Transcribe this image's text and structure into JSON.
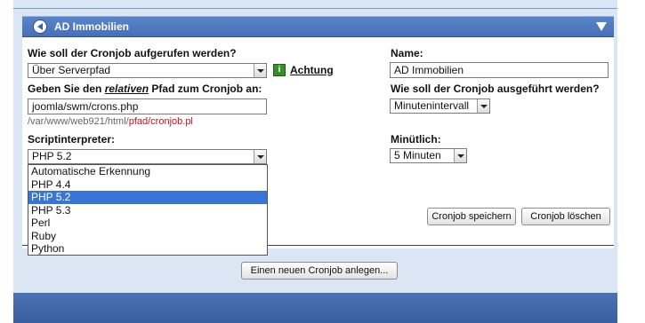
{
  "panel": {
    "title": "AD Immobilien",
    "header_icon": "back-arrow-icon",
    "collapse_icon": "collapse-triangle-icon"
  },
  "form": {
    "call_question": "Wie soll der Cronjob aufgerufen werden?",
    "call_method_value": "Über Serverpfad",
    "warning_icon": "info-icon",
    "warning_icon_glyph": "i",
    "warning_link": "Achtung",
    "path_label_pre": "Geben Sie den ",
    "path_label_em": "relativen",
    "path_label_post": " Pfad zum Cronjob an:",
    "path_value": "joomla/swm/crons.php",
    "path_hint_grey": "/var/www/web921/html/",
    "path_hint_red": "pfad/cronjob.pl",
    "interpreter_label": "Scriptinterpreter:",
    "interpreter_value": "PHP 5.2",
    "interpreter_options": [
      "Automatische Erkennung",
      "PHP 4.4",
      "PHP 5.2",
      "PHP 5.3",
      "Perl",
      "Ruby",
      "Python"
    ],
    "interpreter_selected_index": 2,
    "name_label": "Name:",
    "name_value": "AD Immobilien",
    "exec_label": "Wie soll der Cronjob ausgeführt werden?",
    "exec_value": "Minutenintervall",
    "minutely_label": "Minütlich:",
    "minutely_value": "5 Minuten"
  },
  "buttons": {
    "save": "Cronjob speichern",
    "delete": "Cronjob löschen",
    "new": "Einen neuen Cronjob anlegen..."
  },
  "colors": {
    "header_blue": "#4670b8",
    "selection_blue": "#3875d7",
    "hint_red": "#d0101a",
    "info_green": "#3a8e2a"
  }
}
